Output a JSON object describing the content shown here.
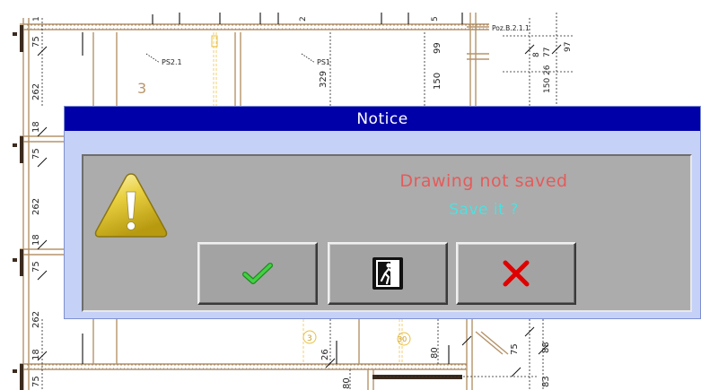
{
  "drawing": {
    "labels": {
      "poz_label": "Poz.B.2.1.1",
      "ps21": "PS2.1",
      "ps1": "PS1",
      "room_number": "3",
      "dim_75_a": "75",
      "dim_262_a": "262",
      "dim_18_a": "18",
      "dim_75_b": "75",
      "dim_262_b": "262",
      "dim_18_b": "18",
      "dim_75_c": "75",
      "dim_262_c": "262",
      "dim_18_c": "18",
      "dim_75_d": "75",
      "dim_99": "99",
      "dim_150": "150",
      "dim_329": "329",
      "dim_150_26": "150 26",
      "dim_77": "77",
      "dim_97": "97",
      "dim_8": "8",
      "dim_26": "26",
      "dim_80": "80",
      "dim_75_e": "75",
      "dim_88": "88",
      "dim_83": "83",
      "dim_80b": "80",
      "marker_3": "3",
      "marker_30": "30",
      "top_2": "2",
      "top_5": "5",
      "top_1": "1"
    }
  },
  "dialog": {
    "title": "Notice",
    "message_line1": "Drawing not saved",
    "message_line2": "Save it ?",
    "icons": {
      "warning": "warning-triangle-icon",
      "yes": "checkmark-icon",
      "exit": "emergency-exit-icon",
      "no": "red-x-icon"
    },
    "colors": {
      "title_bar": "#0000a8",
      "message_line1": "#e65a5a",
      "message_line2": "#4fdfdf",
      "check": "#33c033",
      "cross": "#e00000"
    }
  }
}
